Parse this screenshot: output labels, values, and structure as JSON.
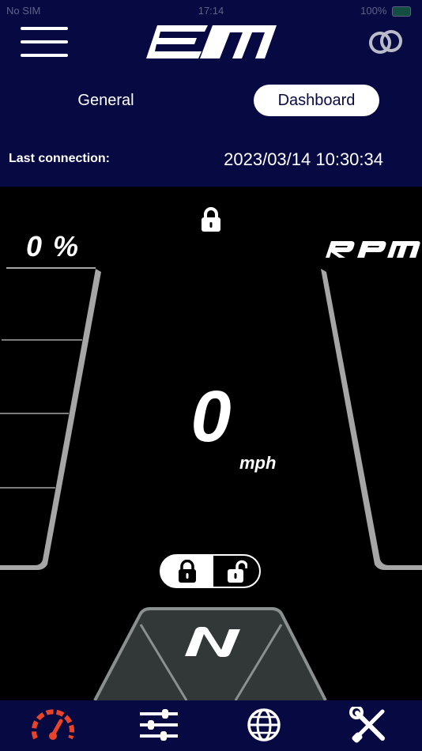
{
  "status_bar": {
    "carrier": "No SIM",
    "time": "17:14",
    "battery": "100%"
  },
  "header": {
    "menu_icon": "hamburger-menu-icon",
    "logo_text": "EM",
    "link_icon": "interlocked-rings-icon"
  },
  "tabs": {
    "general_label": "General",
    "dashboard_label": "Dashboard",
    "active": "Dashboard"
  },
  "connection": {
    "label": "Last connection:",
    "value": "2023/03/14 10:30:34"
  },
  "dashboard": {
    "battery_percent_text": "0 %",
    "rpm_label": "RPM",
    "speed": "0",
    "speed_unit": "mph",
    "gear": "N",
    "lock_state": "locked",
    "top_lock_icon": "padlock-closed-icon",
    "toggle_left_icon": "padlock-closed-icon",
    "toggle_right_icon": "padlock-open-icon"
  },
  "bottom_nav": {
    "items": [
      {
        "icon": "speedometer-icon",
        "active": true
      },
      {
        "icon": "sliders-icon",
        "active": false
      },
      {
        "icon": "globe-icon",
        "active": false
      },
      {
        "icon": "tools-icon",
        "active": false
      }
    ]
  },
  "colors": {
    "header_bg": "#070943",
    "dashboard_bg": "#000000",
    "accent_red": "#e8442a",
    "gauge_gray": "#a6a6a6",
    "gear_panel": "#323838"
  }
}
